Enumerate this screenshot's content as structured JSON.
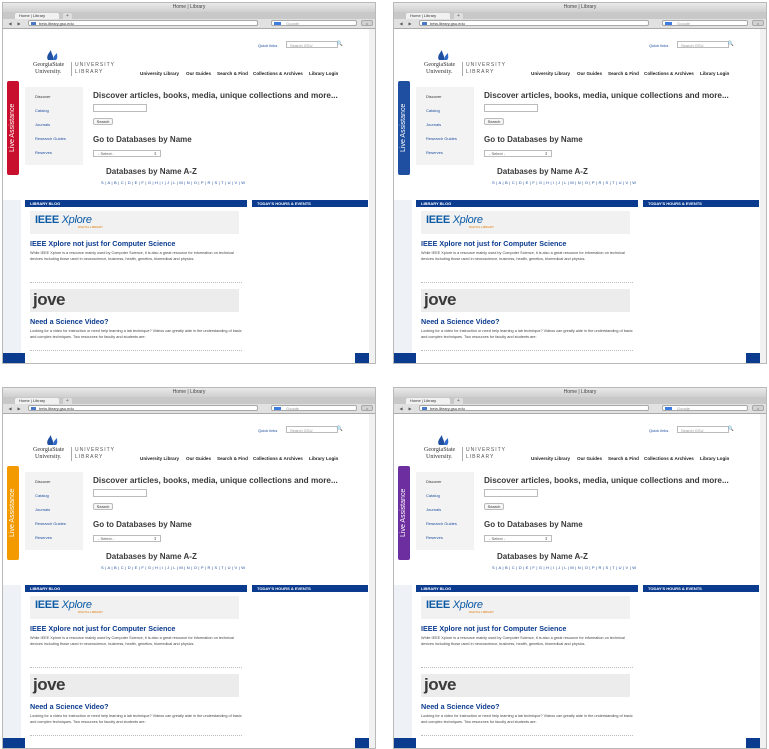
{
  "browser": {
    "window_title": "Home | Library",
    "tab_label": "Home | Library",
    "tab_add": "+",
    "url": "beta.library.gsu.edu",
    "search_placeholder": "Google",
    "back": "◀",
    "forward": "▶",
    "home": "⌂"
  },
  "site": {
    "quick_links": "Quick links",
    "search_placeholder": "Search GSU",
    "search_button": "🔍",
    "logo_line1": "GeorgiaState",
    "logo_line2": "University.",
    "logo_right1": "UNIVERSITY",
    "logo_right2": "LIBRARY",
    "nav": [
      "University Library",
      "Our Guides",
      "Search & Find",
      "Collections & Archives",
      "Library Login"
    ],
    "live_assistance": "Live Assistance",
    "sidebar": [
      "Discover",
      "Catalog",
      "Journals",
      "Research Guides",
      "Reserves"
    ],
    "discover_heading": "Discover articles, books, media, unique collections and more...",
    "search_label": "Search",
    "databases_heading": "Go to Databases by Name",
    "select_value": "- Select -",
    "az_heading": "Databases by Name A-Z",
    "az_links": "S | A | B | C | D | E | F | G | H | I | J | L | M | N | O | P | R | S | T | U | V | W",
    "blog_bar": "LIBRARY BLOG",
    "hours_bar": "TODAY'S HOURS & EVENTS",
    "ieee_logo_word": "IEEE",
    "ieee_logo_x": "Xplore",
    "ieee_logo_sub": "DIGITAL LIBRARY",
    "ieee_heading": "IEEE Xplore not just for Computer Science",
    "ieee_text": "While IEEE Xplore is a resource mainly used by Computer Science, it is also a great resource for information on technical devices including those used in neuroscience, business, health, genetics, biomedical and physics.",
    "jove_logo": "jove",
    "jove_heading": "Need a Science Video?",
    "jove_text": "Looking for a video for instruction or need help learning a lab technique? Videos can greatly aide in the understanding of basic and complex techniques. Two resources for faculty and students are:"
  },
  "colors": {
    "live_tabs": [
      "#c8102e",
      "#1f4fa0",
      "#f29a00",
      "#6d2ea0"
    ],
    "primary": "#0b3b8f"
  }
}
